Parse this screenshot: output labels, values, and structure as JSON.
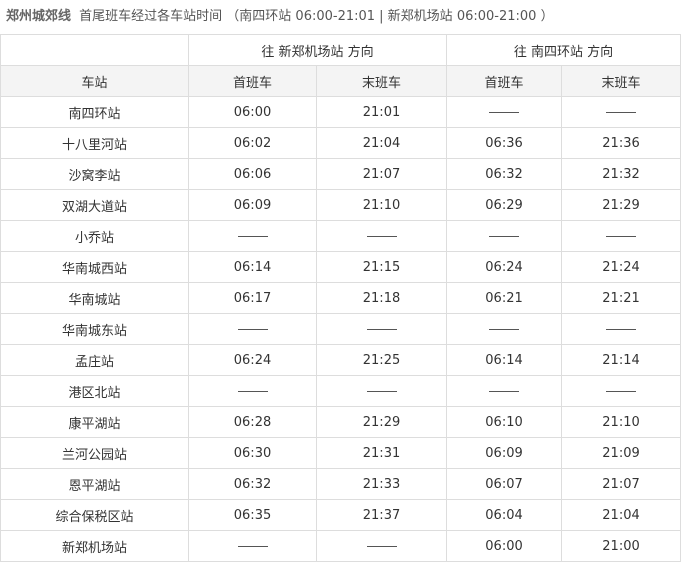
{
  "caption": {
    "line_name": "郑州城郊线",
    "description": "首尾班车经过各车站时间 （南四环站 06:00-21:01 | 新郑机场站 06:00-21:00 ）"
  },
  "table": {
    "directions": [
      "往 新郑机场站 方向",
      "往 南四环站 方向"
    ],
    "columns": [
      "车站",
      "首班车",
      "末班车",
      "首班车",
      "末班车"
    ],
    "no_service": "——",
    "rows": [
      {
        "station": "南四环站",
        "dir1_first": "06:00",
        "dir1_last": "21:01",
        "dir2_first": "——",
        "dir2_last": "——"
      },
      {
        "station": "十八里河站",
        "dir1_first": "06:02",
        "dir1_last": "21:04",
        "dir2_first": "06:36",
        "dir2_last": "21:36"
      },
      {
        "station": "沙窝李站",
        "dir1_first": "06:06",
        "dir1_last": "21:07",
        "dir2_first": "06:32",
        "dir2_last": "21:32"
      },
      {
        "station": "双湖大道站",
        "dir1_first": "06:09",
        "dir1_last": "21:10",
        "dir2_first": "06:29",
        "dir2_last": "21:29"
      },
      {
        "station": "小乔站",
        "dir1_first": "——",
        "dir1_last": "——",
        "dir2_first": "——",
        "dir2_last": "——"
      },
      {
        "station": "华南城西站",
        "dir1_first": "06:14",
        "dir1_last": "21:15",
        "dir2_first": "06:24",
        "dir2_last": "21:24"
      },
      {
        "station": "华南城站",
        "dir1_first": "06:17",
        "dir1_last": "21:18",
        "dir2_first": "06:21",
        "dir2_last": "21:21"
      },
      {
        "station": "华南城东站",
        "dir1_first": "——",
        "dir1_last": "——",
        "dir2_first": "——",
        "dir2_last": "——"
      },
      {
        "station": "孟庄站",
        "dir1_first": "06:24",
        "dir1_last": "21:25",
        "dir2_first": "06:14",
        "dir2_last": "21:14"
      },
      {
        "station": "港区北站",
        "dir1_first": "——",
        "dir1_last": "——",
        "dir2_first": "——",
        "dir2_last": "——"
      },
      {
        "station": "康平湖站",
        "dir1_first": "06:28",
        "dir1_last": "21:29",
        "dir2_first": "06:10",
        "dir2_last": "21:10"
      },
      {
        "station": "兰河公园站",
        "dir1_first": "06:30",
        "dir1_last": "21:31",
        "dir2_first": "06:09",
        "dir2_last": "21:09"
      },
      {
        "station": "恩平湖站",
        "dir1_first": "06:32",
        "dir1_last": "21:33",
        "dir2_first": "06:07",
        "dir2_last": "21:07"
      },
      {
        "station": "综合保税区站",
        "dir1_first": "06:35",
        "dir1_last": "21:37",
        "dir2_first": "06:04",
        "dir2_last": "21:04"
      },
      {
        "station": "新郑机场站",
        "dir1_first": "——",
        "dir1_last": "——",
        "dir2_first": "06:00",
        "dir2_last": "21:00"
      }
    ]
  }
}
